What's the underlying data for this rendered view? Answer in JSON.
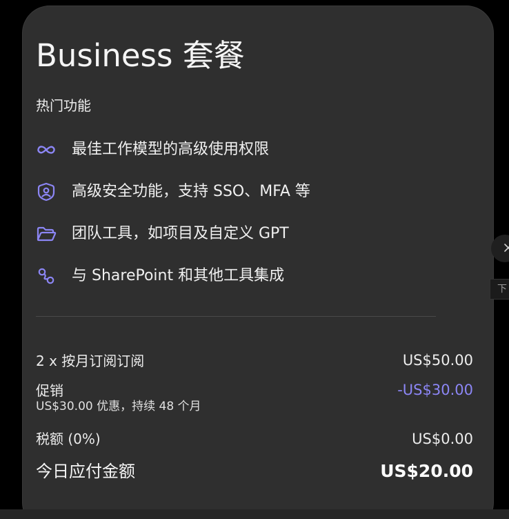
{
  "plan": {
    "title": "Business 套餐",
    "section_label": "热门功能",
    "features": [
      {
        "icon": "infinity-icon",
        "label": "最佳工作模型的高级使用权限"
      },
      {
        "icon": "shield-user-icon",
        "label": "高级安全功能，支持 SSO、MFA 等"
      },
      {
        "icon": "folder-icon",
        "label": "团队工具，如项目及自定义 GPT"
      },
      {
        "icon": "integration-icon",
        "label": "与 SharePoint 和其他工具集成"
      }
    ]
  },
  "billing": {
    "subscription_label": "2 x 按月订阅订阅",
    "subscription_amount": "US$50.00",
    "promo_label": "促销",
    "promo_amount": "-US$30.00",
    "promo_detail": "US$30.00 优惠，持续 48 个月",
    "tax_label": "税额 (0%)",
    "tax_amount": "US$0.00",
    "total_label": "今日应付金额",
    "total_amount": "US$20.00"
  },
  "side": {
    "tooltip_text": "下"
  },
  "colors": {
    "accent": "#8c86f5",
    "card_bg": "#2f2f2f",
    "page_bg": "#000000"
  }
}
